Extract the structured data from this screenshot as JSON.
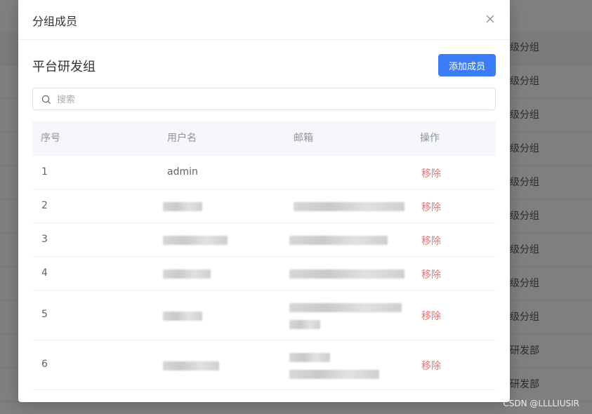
{
  "background": {
    "rows": [
      "级分组",
      "级分组",
      "级分组",
      "级分组",
      "级分组",
      "级分组",
      "级分组",
      "级分组",
      "级分组",
      "研发部",
      "研发部"
    ]
  },
  "watermark": "CSDN @LLLLIUSIR",
  "dialog": {
    "title": "分组成员",
    "group_name": "平台研发组",
    "add_button": "添加成员",
    "search_placeholder": "搜索",
    "columns": [
      "序号",
      "用户名",
      "邮箱",
      "操作"
    ],
    "rows": [
      {
        "index": "1",
        "username": "admin",
        "action": "移除"
      },
      {
        "index": "2",
        "action": "移除"
      },
      {
        "index": "3",
        "action": "移除"
      },
      {
        "index": "4",
        "action": "移除"
      },
      {
        "index": "5",
        "action": "移除"
      },
      {
        "index": "6",
        "action": "移除"
      }
    ]
  }
}
